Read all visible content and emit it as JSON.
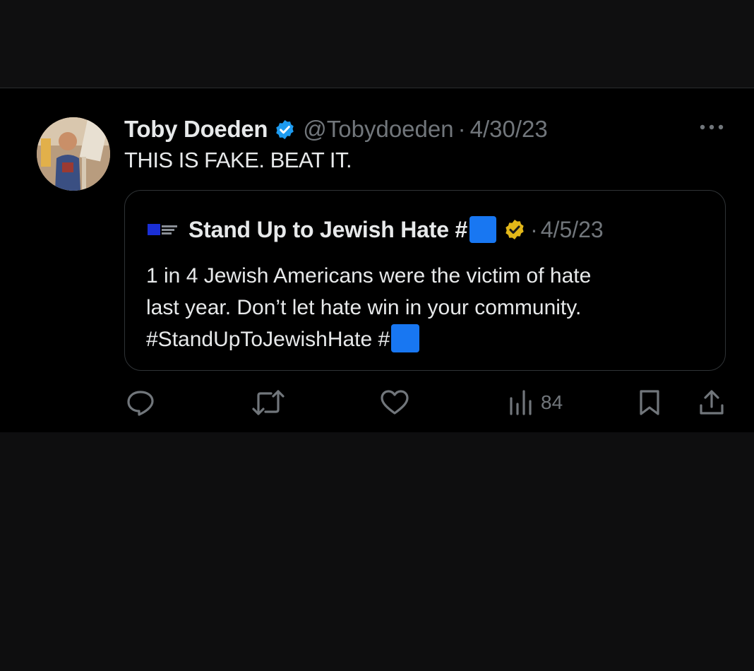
{
  "tweet": {
    "author_name": "Toby Doeden",
    "handle": "@Tobydoeden",
    "separator": "·",
    "date": "4/30/23",
    "text": "THIS IS FAKE. BEAT IT.",
    "verified_color": "#1d9bf0"
  },
  "quote": {
    "author_name": "Stand Up to Jewish Hate #",
    "separator": "·",
    "date": "4/5/23",
    "verified_color": "#e2b719",
    "emoji_color": "#1877f2",
    "line1": "1 in 4 Jewish Americans were the victim of hate",
    "line2": "last year. Don’t let hate win in your community.",
    "line3": "#StandUpToJewishHate  #"
  },
  "actions": {
    "views_count": "84",
    "icons": [
      "reply-icon",
      "retweet-icon",
      "like-icon",
      "views-icon",
      "bookmark-icon",
      "share-icon"
    ],
    "icon_color": "#71767b"
  },
  "colors": {
    "background": "#000000",
    "text_primary": "#e7e9ea",
    "text_secondary": "#71767b"
  }
}
